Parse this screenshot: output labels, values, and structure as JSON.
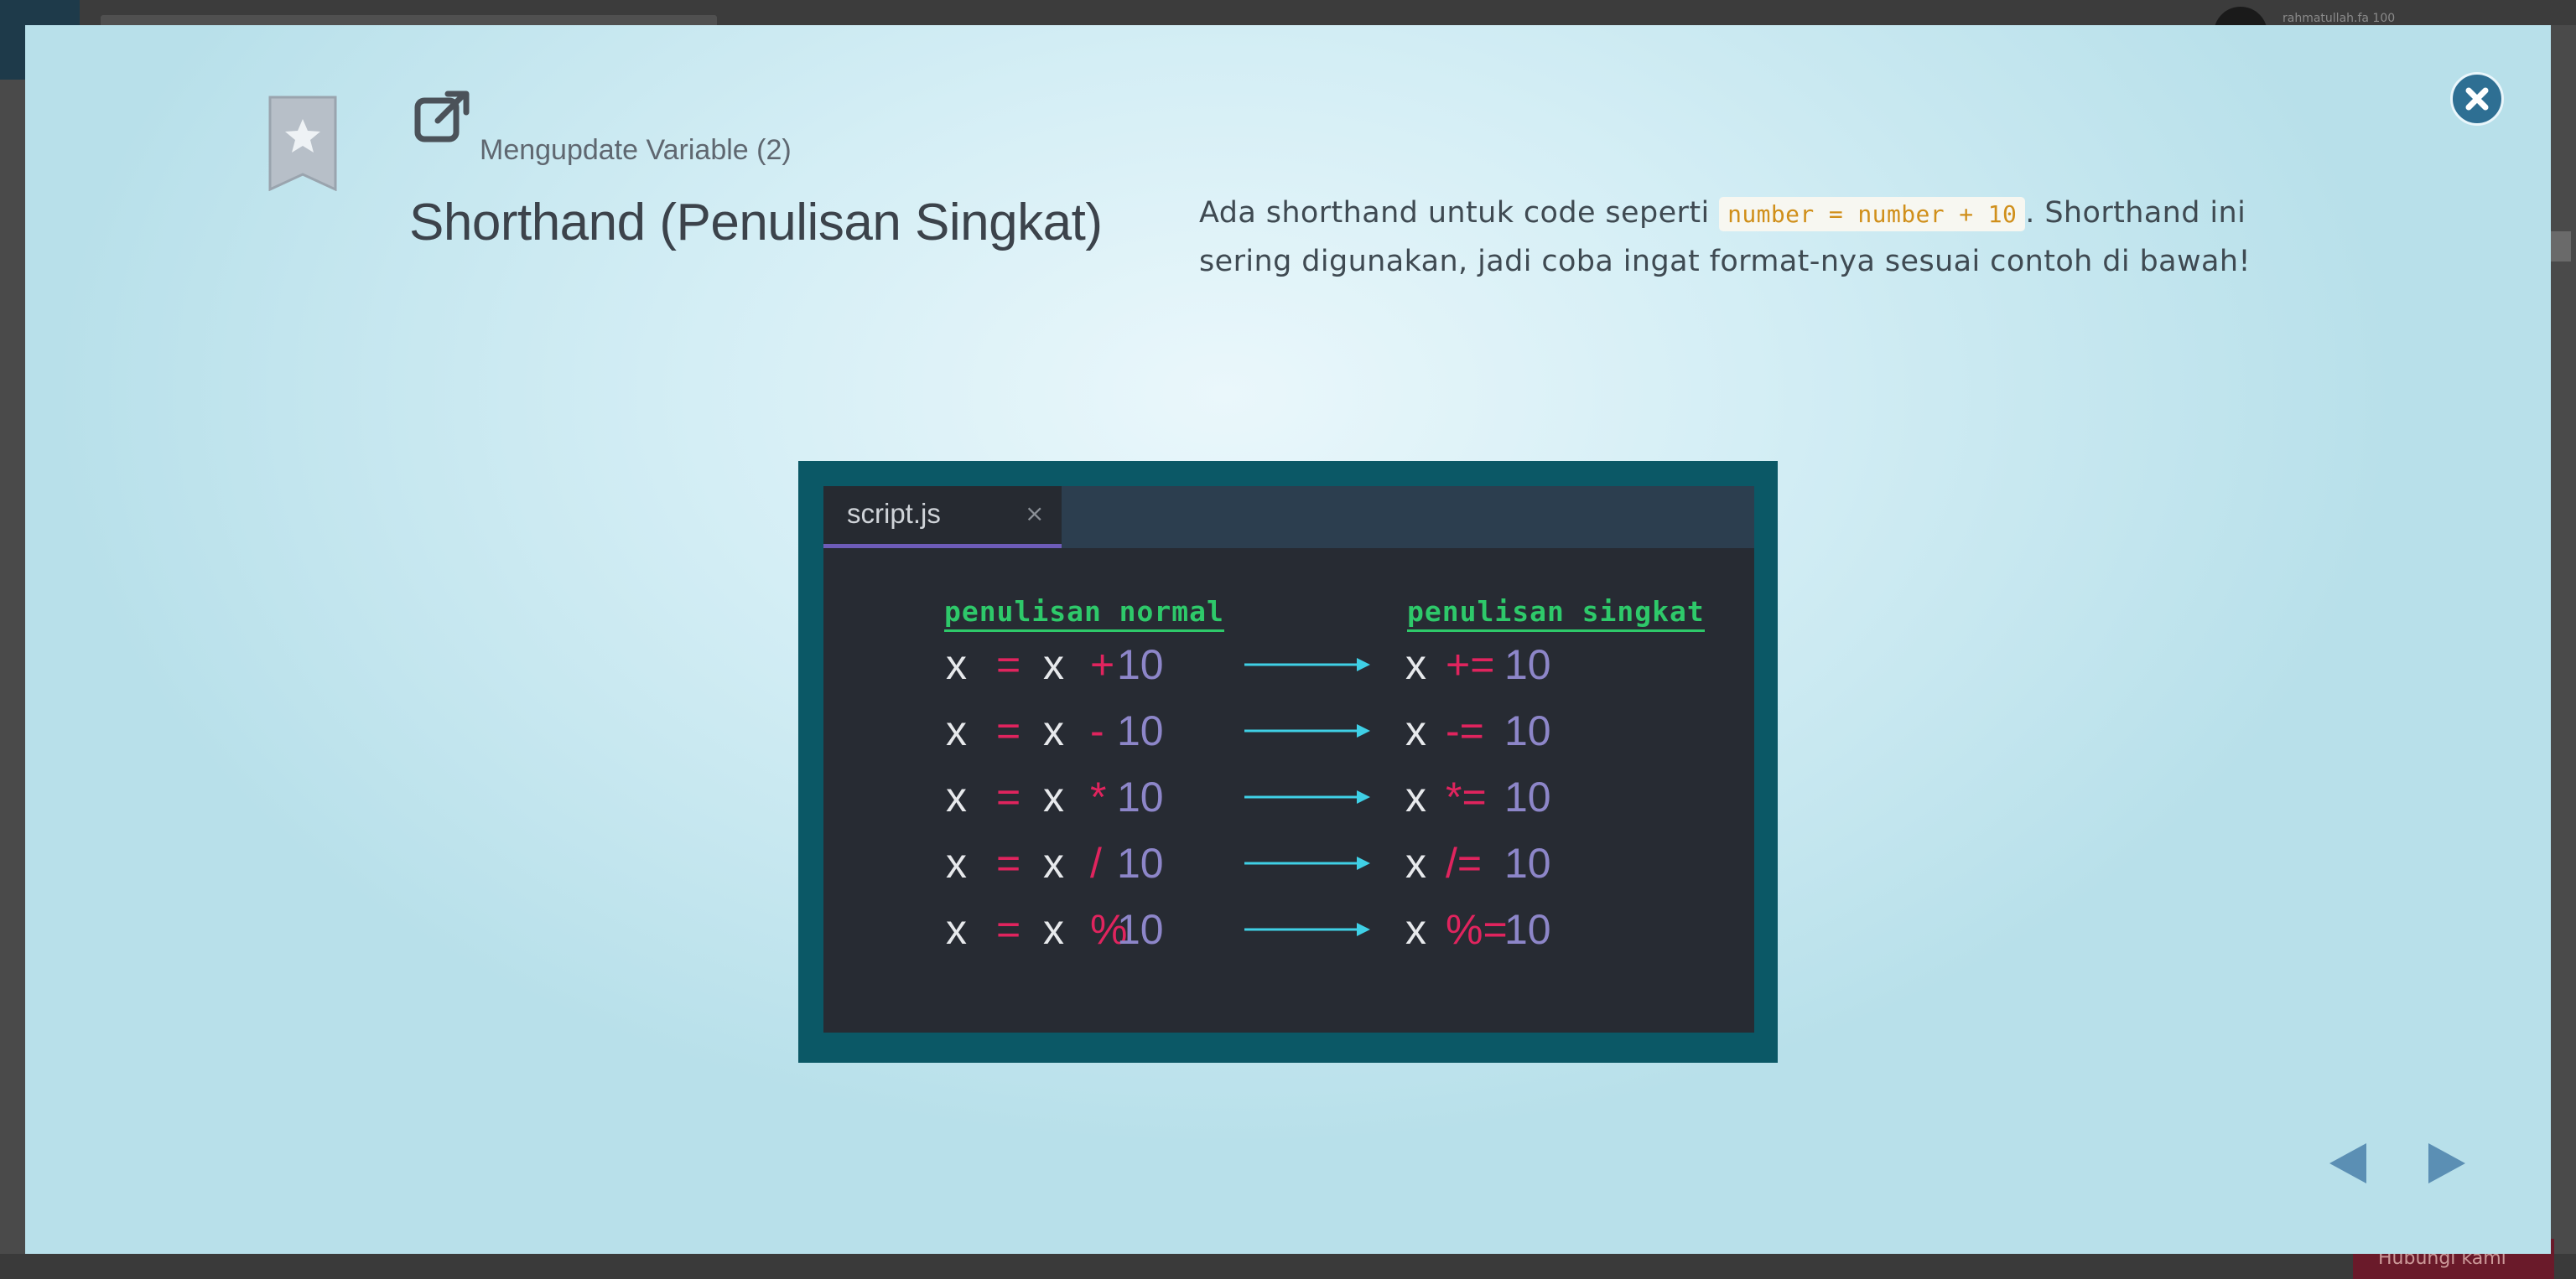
{
  "background": {
    "username": "rahmatullah.fa 100"
  },
  "modal": {
    "icons": {
      "bookmark": "star-bookmark-icon",
      "header": "external-link-icon",
      "close": "close-icon",
      "prev": "triangle-left-icon",
      "next": "triangle-right-icon"
    },
    "subtitle": "Mengupdate Variable (2)",
    "title": "Shorthand (Penulisan Singkat)",
    "description": {
      "part1": "Ada shorthand untuk code seperti ",
      "code": "number = number + 10",
      "part2": ". Shorthand ini sering digunakan, jadi coba ingat format-nya sesuai contoh di bawah!"
    },
    "colors": {
      "close_button": "#2e6f93",
      "nav_arrows": "#5b8fb4",
      "code_inline": "#d08f1a"
    }
  },
  "code_image": {
    "tab": {
      "name": "script.js",
      "close": "×"
    },
    "headers": {
      "normal": "penulisan normal",
      "short": "penulisan singkat"
    },
    "rows": [
      {
        "var": "x",
        "eq": "=",
        "var2": "x",
        "op": "+",
        "num": "10",
        "var3": "x",
        "short_op": "+=",
        "num2": "10"
      },
      {
        "var": "x",
        "eq": "=",
        "var2": "x",
        "op": "-",
        "num": "10",
        "var3": "x",
        "short_op": "-=",
        "num2": "10"
      },
      {
        "var": "x",
        "eq": "=",
        "var2": "x",
        "op": "*",
        "num": "10",
        "var3": "x",
        "short_op": "*=",
        "num2": "10"
      },
      {
        "var": "x",
        "eq": "=",
        "var2": "x",
        "op": "/",
        "num": "10",
        "var3": "x",
        "short_op": "/=",
        "num2": "10"
      },
      {
        "var": "x",
        "eq": "=",
        "var2": "x",
        "op": "%",
        "num": "10",
        "var3": "x",
        "short_op": "%=",
        "num2": "10"
      }
    ],
    "colors": {
      "frame": "#0b5866",
      "editor_bg": "#272b33",
      "header_green": "#2ec96a",
      "operator_red": "#e0245e",
      "number_purple": "#8d86c9",
      "arrow_cyan": "#3fd0e6"
    }
  },
  "footer": {
    "button_label": "Hubungi kami"
  }
}
